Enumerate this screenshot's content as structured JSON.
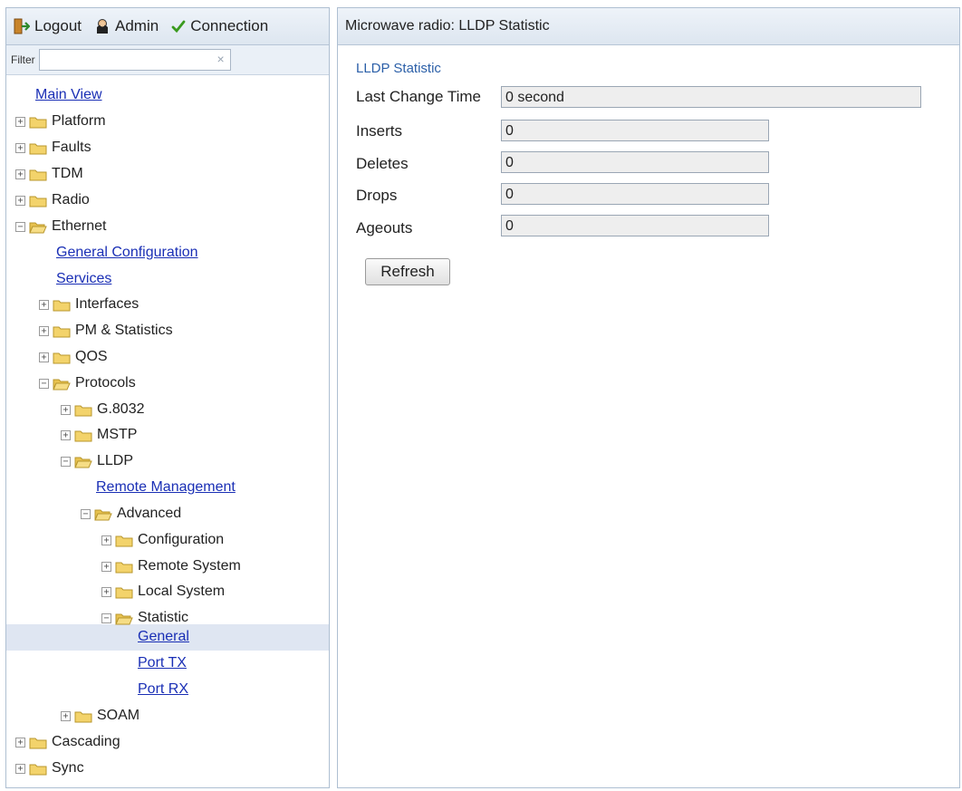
{
  "topbar": {
    "logout": "Logout",
    "admin": "Admin",
    "connection": "Connection"
  },
  "filter": {
    "label": "Filter",
    "value": "",
    "clear": "×"
  },
  "tree": {
    "main_view": "Main View",
    "platform": "Platform",
    "faults": "Faults",
    "tdm": "TDM",
    "radio": "Radio",
    "ethernet": "Ethernet",
    "general_configuration": "General Configuration",
    "services": "Services",
    "interfaces": "Interfaces",
    "pm_statistics": "PM & Statistics",
    "qos": "QOS",
    "protocols": "Protocols",
    "g8032": "G.8032",
    "mstp": "MSTP",
    "lldp": "LLDP",
    "remote_management": "Remote Management",
    "advanced": "Advanced",
    "configuration": "Configuration",
    "remote_system": "Remote System",
    "local_system": "Local System",
    "statistic": "Statistic",
    "general": "General",
    "port_tx": "Port TX",
    "port_rx": "Port RX",
    "soam": "SOAM",
    "cascading": "Cascading",
    "sync": "Sync",
    "expand_glyph": "+",
    "collapse_glyph": "−"
  },
  "panel": {
    "header": "Microwave radio: LLDP Statistic",
    "section_title": "LLDP Statistic",
    "fields": {
      "last_change_time": {
        "label": "Last Change Time",
        "value": "0 second"
      },
      "inserts": {
        "label": "Inserts",
        "value": "0"
      },
      "deletes": {
        "label": "Deletes",
        "value": "0"
      },
      "drops": {
        "label": "Drops",
        "value": "0"
      },
      "ageouts": {
        "label": "Ageouts",
        "value": "0"
      }
    },
    "refresh_label": "Refresh"
  },
  "colors": {
    "link": "#1a2fb5",
    "section_title": "#2b5fa8",
    "selected_row": "#dfe6f2",
    "folder": "#f3d36b",
    "check": "#3a9a1e"
  }
}
